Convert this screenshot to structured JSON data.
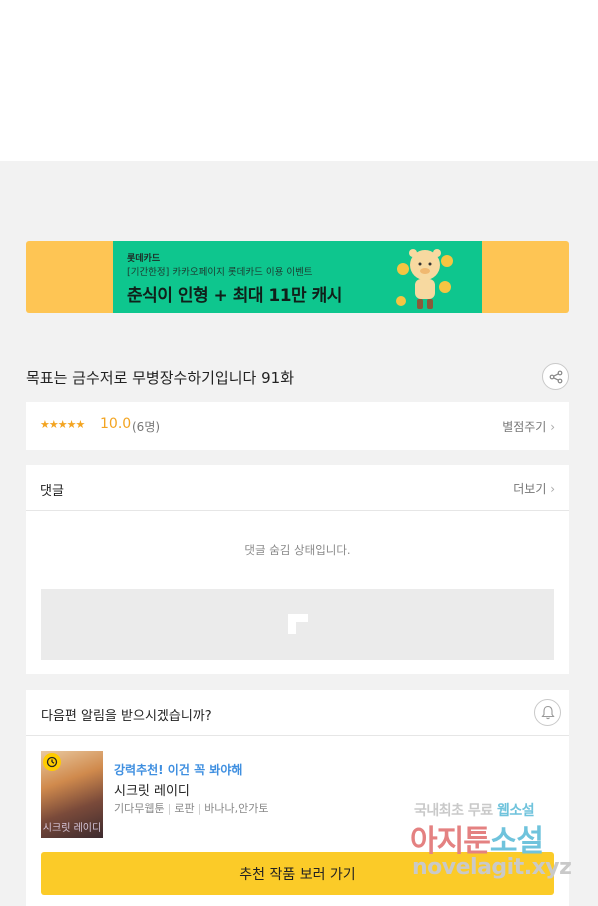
{
  "banner": {
    "brand": "롯데카드",
    "subtitle": "[기간한정] 카카오페이지 롯데카드 이용 이벤트",
    "headline": "춘식이 인형 + 최대 11만 캐시",
    "colors": {
      "outer": "#fec554",
      "inner": "#0ec68e"
    }
  },
  "episode": {
    "title": "목표는 금수저로 무병장수하기입니다 91화"
  },
  "rating": {
    "stars": "★★★★★",
    "score": "10.0",
    "count": "(6명)",
    "action_label": "별점주기"
  },
  "comments": {
    "title": "댓글",
    "more_label": "더보기",
    "hidden_message": "댓글 숨김 상태입니다."
  },
  "next_episode": {
    "question": "다음편 알림을 받으시겠습니까?",
    "recommend_label": "강력추천! 이건 꼭 봐야해",
    "work_title": "시크릿 레이디",
    "meta": [
      "기다무웹툰",
      "로판",
      "바나나,안가토"
    ],
    "thumb_text": "시크릿 레이디",
    "button_label": "추천 작품 보러 가기"
  },
  "watermark": {
    "line1_prefix": "국내최초 무료 ",
    "line1_highlight": "웹소설",
    "line2_prefix": "아지툰",
    "line2_highlight": "소설",
    "line3": "novelagit.xyz"
  },
  "icons": {
    "share": "share-icon",
    "bell": "bell-icon",
    "clock_badge": "clock-icon",
    "chevron": "chevron-right-icon"
  },
  "colors": {
    "accent_yellow": "#fbcb28",
    "rating_orange": "#f3a421",
    "recommend_blue": "#3f8fe0"
  }
}
